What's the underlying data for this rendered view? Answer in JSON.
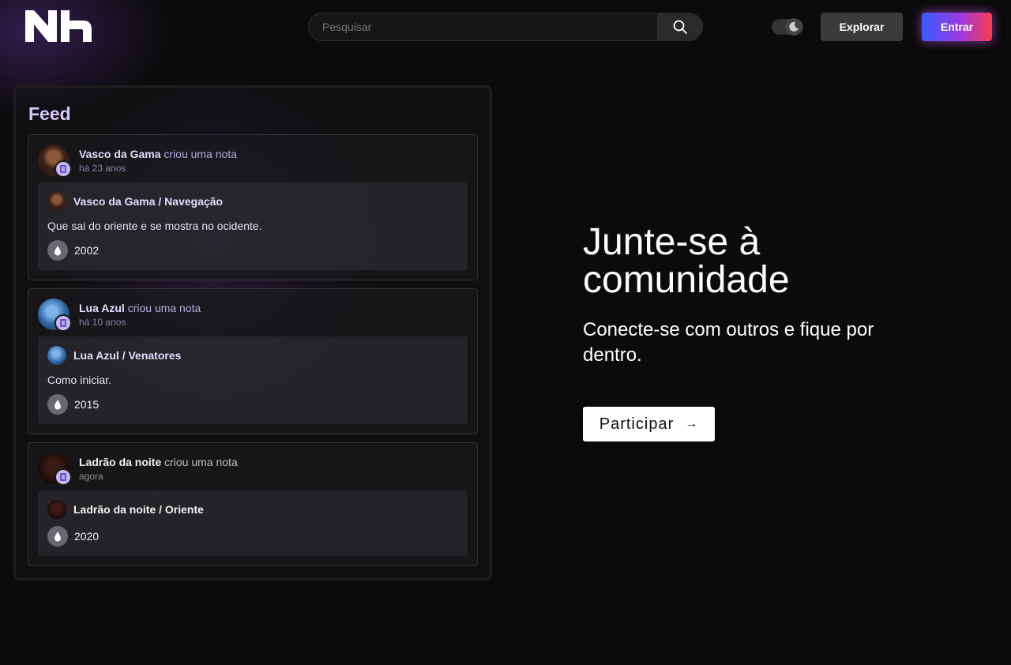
{
  "header": {
    "logo_text": "Nh",
    "search_placeholder": "Pesquisar",
    "explore_label": "Explorar",
    "enter_label": "Entrar"
  },
  "feed": {
    "title": "Feed",
    "items": [
      {
        "user": "Vasco da Gama",
        "action": "criou uma nota",
        "time": "há 23 anos",
        "note_title": "Vasco da Gama / Navegação",
        "note_text": "Que sai do oriente e se mostra no ocidente.",
        "stat": "2002"
      },
      {
        "user": "Lua Azul",
        "action": "criou uma nota",
        "time": "há 10 anos",
        "note_title": "Lua Azul / Venatores",
        "note_text": "Como iniciar.",
        "stat": "2015"
      },
      {
        "user": "Ladrão da noite",
        "action": "criou uma nota",
        "time": "agora",
        "note_title": "Ladrão da noite / Oriente",
        "note_text": "",
        "stat": "2020"
      }
    ]
  },
  "hero": {
    "title": "Junte-se à comunidade",
    "subtitle": "Conecte-se com outros e fique por dentro.",
    "join_label": "Participar",
    "join_arrow": "→"
  },
  "colors": {
    "accent_purple": "#c6b8f2",
    "background": "#0b0b0b",
    "enter_gradient_start": "#3a5bff",
    "enter_gradient_end": "#ff3b4a"
  }
}
